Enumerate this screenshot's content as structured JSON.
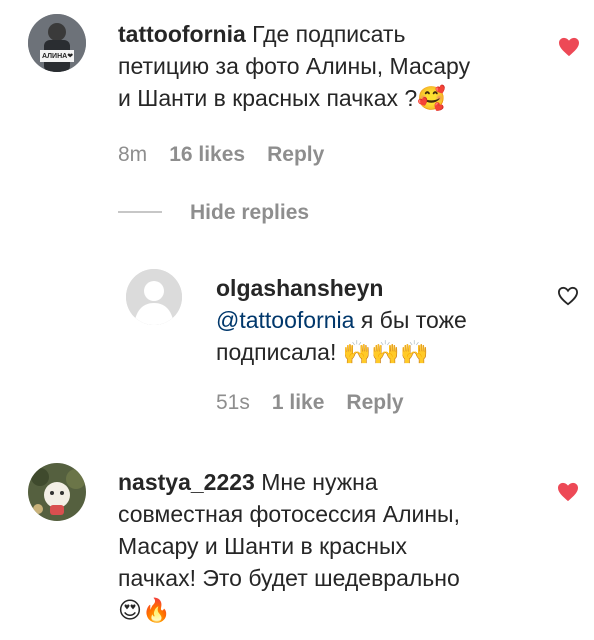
{
  "comments": [
    {
      "username": "tattoofornia",
      "text_lines": [
        "Где подписать",
        "петицию за фото Алины, Масару",
        "и Шанти в красных пачках ?🥰"
      ],
      "time": "8m",
      "likes": "16 likes",
      "reply": "Reply",
      "liked": true,
      "avatar_sign": "АЛИНА❤"
    },
    {
      "username": "olgashansheyn",
      "mention": "@tattoofornia",
      "text_lines": [
        " я бы тоже",
        "подписала! 🙌🙌🙌"
      ],
      "time": "51s",
      "likes": "1 like",
      "reply": "Reply",
      "liked": false
    },
    {
      "username": "nastya_2223",
      "text_lines": [
        " Мне нужна",
        "совместная фотосессия Алины,",
        "Масару и Шанти в красных",
        "пачках! Это будет шедеврально",
        "😍🔥"
      ],
      "liked": true
    }
  ],
  "hide_replies": "Hide replies",
  "colors": {
    "like_red": "#ed4956",
    "mention_blue": "#00376b",
    "meta_gray": "#8e8e8e"
  }
}
